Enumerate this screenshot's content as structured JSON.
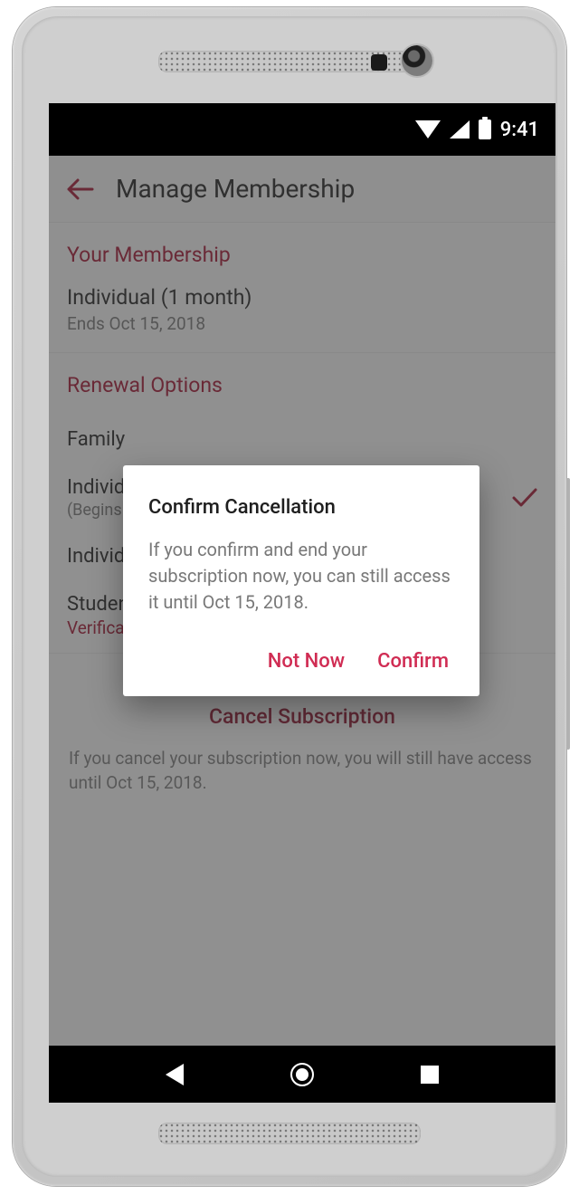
{
  "status_bar": {
    "time": "9:41"
  },
  "header": {
    "title": "Manage Membership"
  },
  "membership": {
    "section_title": "Your Membership",
    "plan": "Individual (1 month)",
    "ends": "Ends Oct 15, 2018"
  },
  "renewal": {
    "section_title": "Renewal Options",
    "options": [
      {
        "label": "Family",
        "selected": false
      },
      {
        "label": "Individual",
        "sub": "(Begins",
        "selected": true
      },
      {
        "label": "Individual",
        "selected": false
      },
      {
        "label": "Student",
        "verification": "Verification",
        "selected": false
      }
    ]
  },
  "cancel": {
    "button": "Cancel Subscription",
    "note": "If you cancel your subscription now, you will still have access until Oct 15, 2018."
  },
  "dialog": {
    "title": "Confirm Cancellation",
    "body": "If you confirm and end your subscription now, you can still access it until Oct 15, 2018.",
    "not_now": "Not Now",
    "confirm": "Confirm"
  },
  "colors": {
    "accent": "#a31432",
    "action": "#d02c53"
  }
}
